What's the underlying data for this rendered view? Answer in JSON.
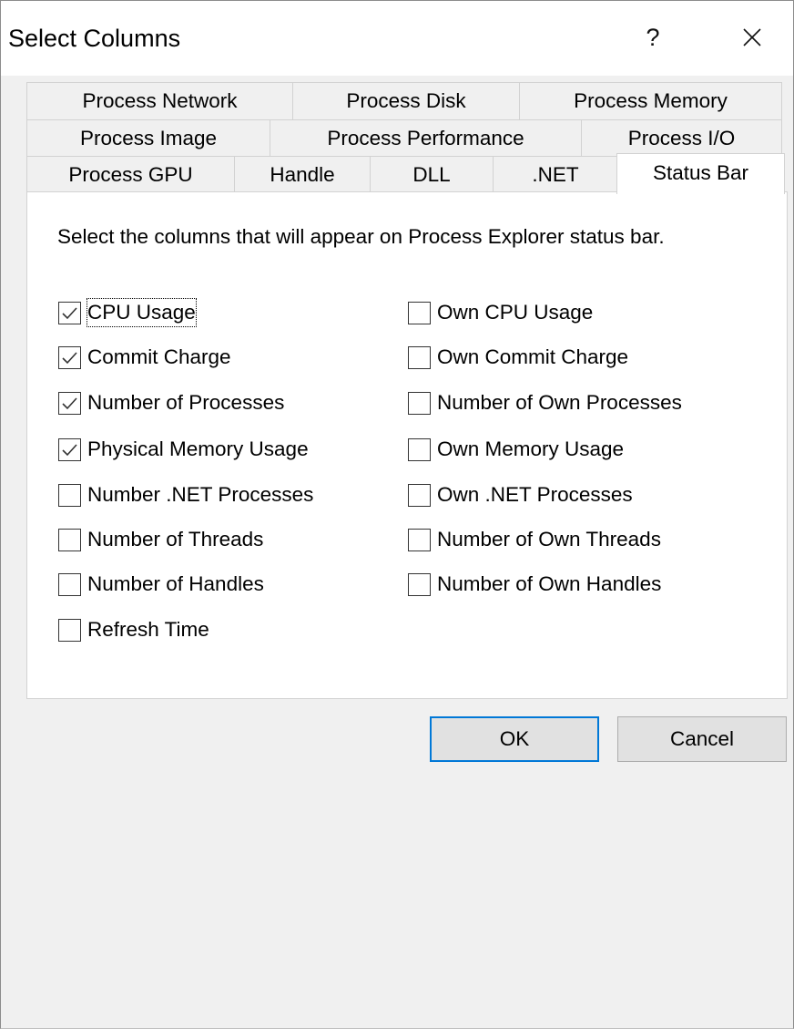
{
  "window": {
    "title": "Select Columns",
    "help_label": "?",
    "close_icon": "close-icon"
  },
  "tabs": {
    "row1": [
      "Process Network",
      "Process Disk",
      "Process Memory"
    ],
    "row2": [
      "Process Image",
      "Process Performance",
      "Process I/O"
    ],
    "row3": [
      "Process GPU",
      "Handle",
      "DLL",
      ".NET",
      "Status Bar"
    ],
    "selected": "Status Bar"
  },
  "panel": {
    "description": "Select the columns that will appear on Process Explorer status bar.",
    "left_options": [
      {
        "label": "CPU Usage",
        "checked": true
      },
      {
        "label": "Commit Charge",
        "checked": true
      },
      {
        "label": "Number of Processes",
        "checked": true
      },
      {
        "label": "Physical Memory Usage",
        "checked": true
      },
      {
        "label": "Number .NET Processes",
        "checked": false
      },
      {
        "label": "Number of Threads",
        "checked": false
      },
      {
        "label": "Number of Handles",
        "checked": false
      },
      {
        "label": "Refresh Time",
        "checked": false
      }
    ],
    "right_options": [
      {
        "label": "Own CPU Usage",
        "checked": false
      },
      {
        "label": "Own Commit Charge",
        "checked": false
      },
      {
        "label": "Number of Own Processes",
        "checked": false
      },
      {
        "label": "Own Memory Usage",
        "checked": false
      },
      {
        "label": "Own .NET Processes",
        "checked": false
      },
      {
        "label": "Number of Own Threads",
        "checked": false
      },
      {
        "label": "Number of Own Handles",
        "checked": false
      }
    ]
  },
  "buttons": {
    "ok": "OK",
    "cancel": "Cancel"
  },
  "colors": {
    "default_button_border": "#0078d7",
    "dialog_background": "#f0f0f0",
    "panel_background": "#ffffff"
  }
}
